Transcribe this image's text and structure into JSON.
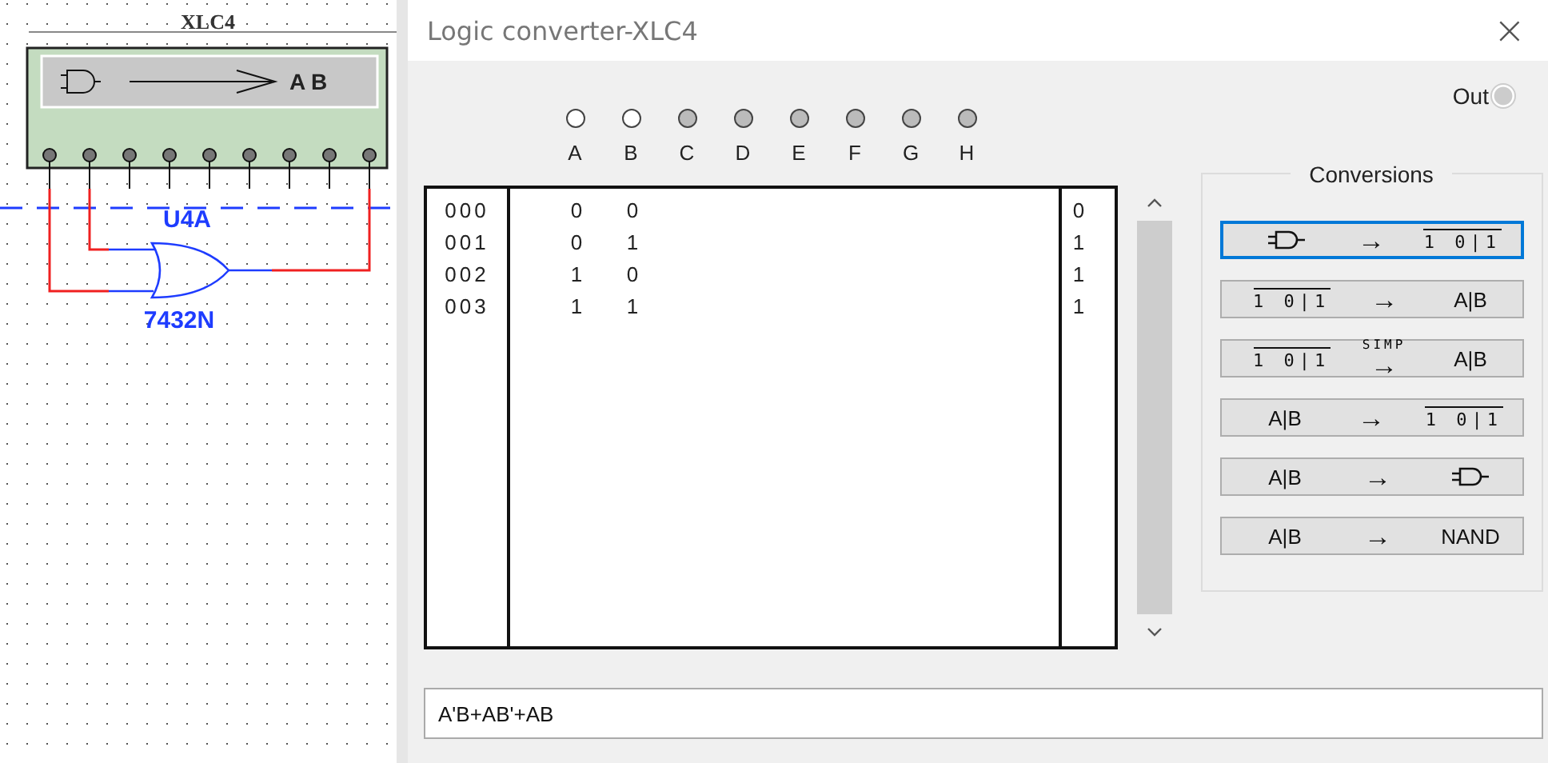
{
  "schematic": {
    "instrument_label": "XLC4",
    "instrument_display": "A B",
    "gate_label": "U4A",
    "part_label": "7432N"
  },
  "window": {
    "title": "Logic converter-XLC4",
    "close": "×"
  },
  "inputs": [
    {
      "label": "A",
      "active": true
    },
    {
      "label": "B",
      "active": true
    },
    {
      "label": "C",
      "active": false
    },
    {
      "label": "D",
      "active": false
    },
    {
      "label": "E",
      "active": false
    },
    {
      "label": "F",
      "active": false
    },
    {
      "label": "G",
      "active": false
    },
    {
      "label": "H",
      "active": false
    }
  ],
  "output": {
    "label": "Out",
    "on": false
  },
  "truth_table": {
    "rows": [
      {
        "index": "000",
        "inputs": [
          "0",
          "0"
        ],
        "output": "0"
      },
      {
        "index": "001",
        "inputs": [
          "0",
          "1"
        ],
        "output": "1"
      },
      {
        "index": "002",
        "inputs": [
          "1",
          "0"
        ],
        "output": "1"
      },
      {
        "index": "003",
        "inputs": [
          "1",
          "1"
        ],
        "output": "1"
      }
    ]
  },
  "conversions": {
    "title": "Conversions",
    "buttons": [
      {
        "selected": true,
        "from": {
          "kind": "gate"
        },
        "arrow": "→",
        "to": {
          "kind": "table",
          "text": "1 0|1"
        }
      },
      {
        "selected": false,
        "from": {
          "kind": "table",
          "text": "1 0|1"
        },
        "arrow": "→",
        "to": {
          "kind": "text",
          "text": "A|B"
        }
      },
      {
        "selected": false,
        "from": {
          "kind": "table",
          "text": "1 0|1"
        },
        "arrow": "→",
        "arrow_label": "SIMP",
        "to": {
          "kind": "text",
          "text": "A|B"
        }
      },
      {
        "selected": false,
        "from": {
          "kind": "text",
          "text": "A|B"
        },
        "arrow": "→",
        "to": {
          "kind": "table",
          "text": "1 0|1"
        }
      },
      {
        "selected": false,
        "from": {
          "kind": "text",
          "text": "A|B"
        },
        "arrow": "→",
        "to": {
          "kind": "gate"
        }
      },
      {
        "selected": false,
        "from": {
          "kind": "text",
          "text": "A|B"
        },
        "arrow": "→",
        "to": {
          "kind": "text",
          "text": "NAND"
        }
      }
    ]
  },
  "expression": {
    "value": "A'B+AB'+AB"
  }
}
